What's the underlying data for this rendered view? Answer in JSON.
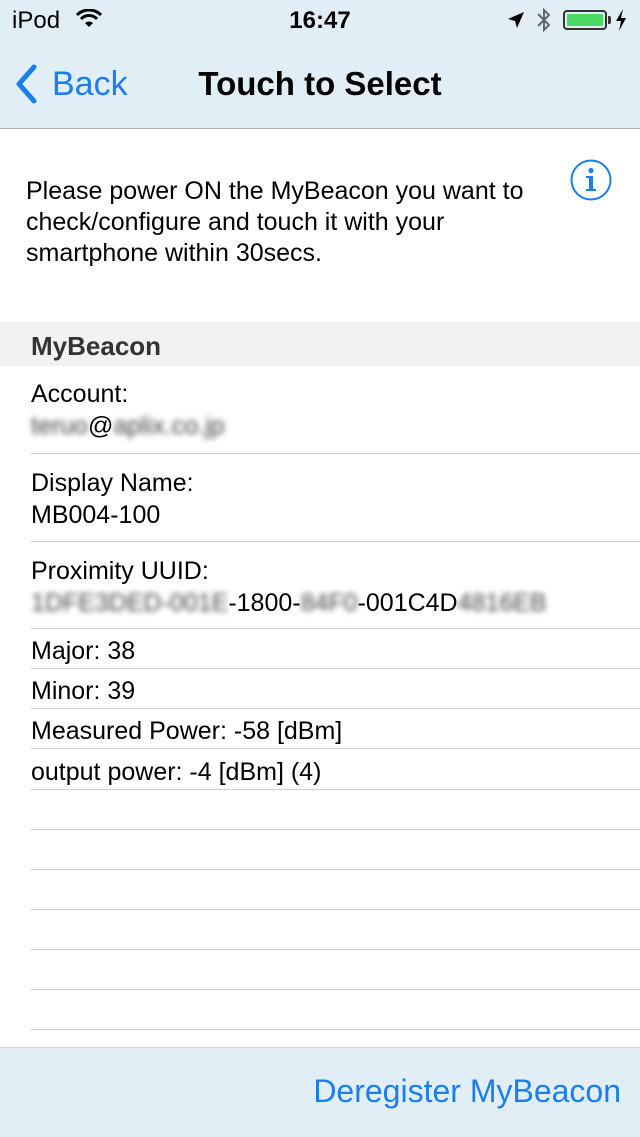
{
  "status_bar": {
    "carrier": "iPod",
    "time": "16:47",
    "icons": [
      "wifi-icon",
      "location-arrow-icon",
      "bluetooth-icon",
      "battery-icon",
      "charging-bolt-icon"
    ]
  },
  "nav": {
    "back_label": "Back",
    "title": "Touch to Select"
  },
  "instructions": "Please power ON the MyBeacon you want to check/configure and touch it with your smartphone within 30secs.",
  "section": {
    "header": "MyBeacon",
    "account": {
      "label": "Account:",
      "value_blur_1": "teruo",
      "value_at": "@",
      "value_blur_2": "aplix.co.jp"
    },
    "display_name": {
      "label": "Display Name:",
      "value": "MB004-100"
    },
    "uuid": {
      "label": "Proximity UUID:",
      "part1_blur": "1DFE3DED-001E",
      "part2": "-1800-",
      "part3_blur": "84F0",
      "part4": "-001C4D",
      "part5_blur": "4816EB"
    },
    "major": "Major:  38",
    "minor": "Minor:  39",
    "measured_power": "Measured Power:  -58 [dBm]",
    "output_power": "output power:  -4 [dBm]  (4)"
  },
  "toolbar": {
    "deregister_label": "Deregister MyBeacon"
  },
  "colors": {
    "accent": "#1a7ef0",
    "bar_bg": "#e1eef6",
    "section_bg": "#f2f2f4",
    "battery": "#4cd964"
  }
}
